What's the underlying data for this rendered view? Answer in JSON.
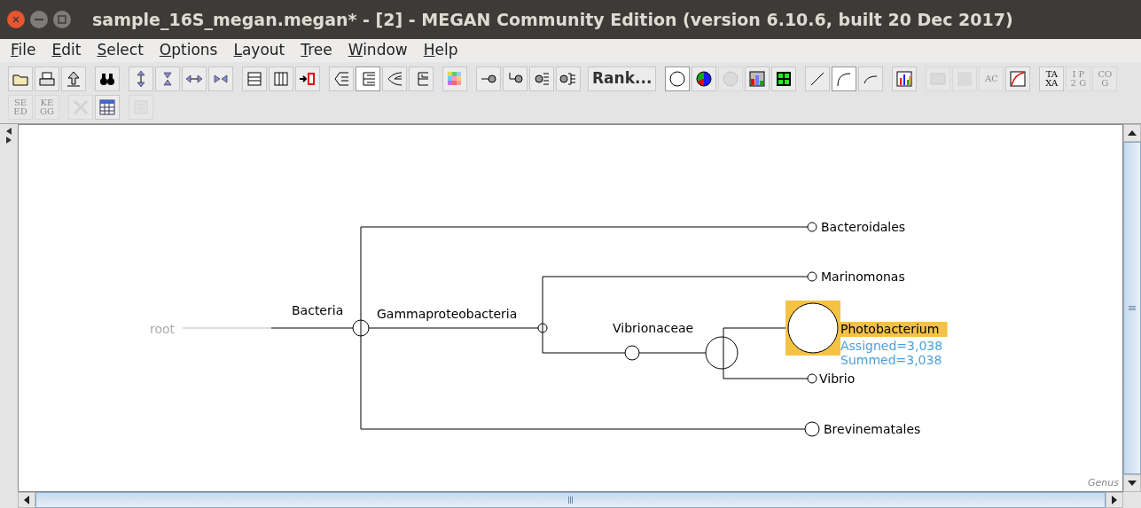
{
  "window": {
    "title": "sample_16S_megan.megan* - [2] - MEGAN Community Edition (version 6.10.6, built 20 Dec 2017)"
  },
  "menu": [
    {
      "label": "File"
    },
    {
      "label": "Edit"
    },
    {
      "label": "Select"
    },
    {
      "label": "Options"
    },
    {
      "label": "Layout"
    },
    {
      "label": "Tree"
    },
    {
      "label": "Window"
    },
    {
      "label": "Help"
    }
  ],
  "toolbar": {
    "rows": [
      {
        "groups": [
          [
            {
              "kind": "icon",
              "selected": false,
              "disabled": false
            },
            {
              "kind": "icon",
              "selected": false,
              "disabled": false
            },
            {
              "kind": "icon",
              "selected": false,
              "disabled": false
            }
          ],
          [
            {
              "kind": "icon",
              "selected": false,
              "disabled": false
            }
          ],
          [
            {
              "kind": "icon",
              "selected": false,
              "disabled": false
            },
            {
              "kind": "icon",
              "selected": false,
              "disabled": false
            },
            {
              "kind": "icon",
              "selected": false,
              "disabled": false
            },
            {
              "kind": "icon",
              "selected": false,
              "disabled": false
            }
          ],
          [
            {
              "kind": "icon",
              "selected": false,
              "disabled": false
            },
            {
              "kind": "icon",
              "selected": false,
              "disabled": false
            },
            {
              "kind": "icon",
              "selected": false,
              "disabled": false
            }
          ],
          [
            {
              "kind": "icon",
              "selected": false,
              "disabled": false
            },
            {
              "kind": "icon",
              "selected": true,
              "disabled": false
            },
            {
              "kind": "icon",
              "selected": false,
              "disabled": false
            },
            {
              "kind": "icon",
              "selected": false,
              "disabled": false
            }
          ],
          [
            {
              "kind": "icon",
              "selected": false,
              "disabled": false
            }
          ],
          [
            {
              "kind": "icon",
              "selected": false,
              "disabled": false
            },
            {
              "kind": "icon",
              "selected": false,
              "disabled": false
            },
            {
              "kind": "icon",
              "selected": false,
              "disabled": false
            },
            {
              "kind": "icon",
              "selected": false,
              "disabled": false
            },
            {
              "kind": "button",
              "label": "Rank...",
              "disabled": false
            }
          ],
          [
            {
              "kind": "icon",
              "selected": true,
              "disabled": false
            },
            {
              "kind": "icon",
              "selected": false,
              "disabled": false
            },
            {
              "kind": "icon",
              "selected": false,
              "disabled": true
            },
            {
              "kind": "icon",
              "selected": false,
              "disabled": false
            },
            {
              "kind": "icon",
              "selected": false,
              "disabled": false
            }
          ],
          [
            {
              "kind": "icon",
              "selected": false,
              "disabled": false
            },
            {
              "kind": "icon",
              "selected": true,
              "disabled": false
            },
            {
              "kind": "icon",
              "selected": false,
              "disabled": false
            }
          ],
          [
            {
              "kind": "icon",
              "selected": false,
              "disabled": false
            }
          ],
          [
            {
              "kind": "icon",
              "selected": false,
              "disabled": true
            },
            {
              "kind": "icon",
              "selected": false,
              "disabled": true
            },
            {
              "kind": "glyph",
              "label": "AC",
              "disabled": true
            },
            {
              "kind": "icon",
              "selected": false,
              "disabled": false
            }
          ],
          [
            {
              "kind": "glyph",
              "label": "TA XA",
              "disabled": false
            },
            {
              "kind": "glyph",
              "label": "I P 2 G",
              "disabled": true
            },
            {
              "kind": "glyph",
              "label": "CO G",
              "disabled": true
            }
          ]
        ]
      },
      {
        "groups": [
          [
            {
              "kind": "glyph",
              "label": "SE ED",
              "disabled": true
            },
            {
              "kind": "glyph",
              "label": "KE GG",
              "disabled": true
            }
          ],
          [
            {
              "kind": "icon",
              "selected": false,
              "disabled": true
            },
            {
              "kind": "icon",
              "selected": false,
              "disabled": false
            }
          ],
          [
            {
              "kind": "icon",
              "selected": false,
              "disabled": true
            }
          ]
        ]
      }
    ]
  },
  "tree": {
    "label": "root",
    "disabled": true,
    "selected": false,
    "children": [
      {
        "label": "Bacteria",
        "selected": false,
        "children": [
          {
            "label": "Bacteroidales",
            "selected": false
          },
          {
            "label": "Gammaproteobacteria",
            "selected": false,
            "children": [
              {
                "label": "Marinomonas",
                "selected": false
              },
              {
                "label": "Vibrionaceae",
                "selected": false,
                "children": [
                  {
                    "label": "Photobacterium",
                    "selected": true,
                    "assigned": "Assigned=3,038",
                    "summed": "Summed=3,038"
                  },
                  {
                    "label": "Vibrio",
                    "selected": false
                  }
                ]
              }
            ]
          },
          {
            "label": "Brevinematales",
            "selected": false
          }
        ]
      }
    ]
  },
  "rank_label": "Genus"
}
